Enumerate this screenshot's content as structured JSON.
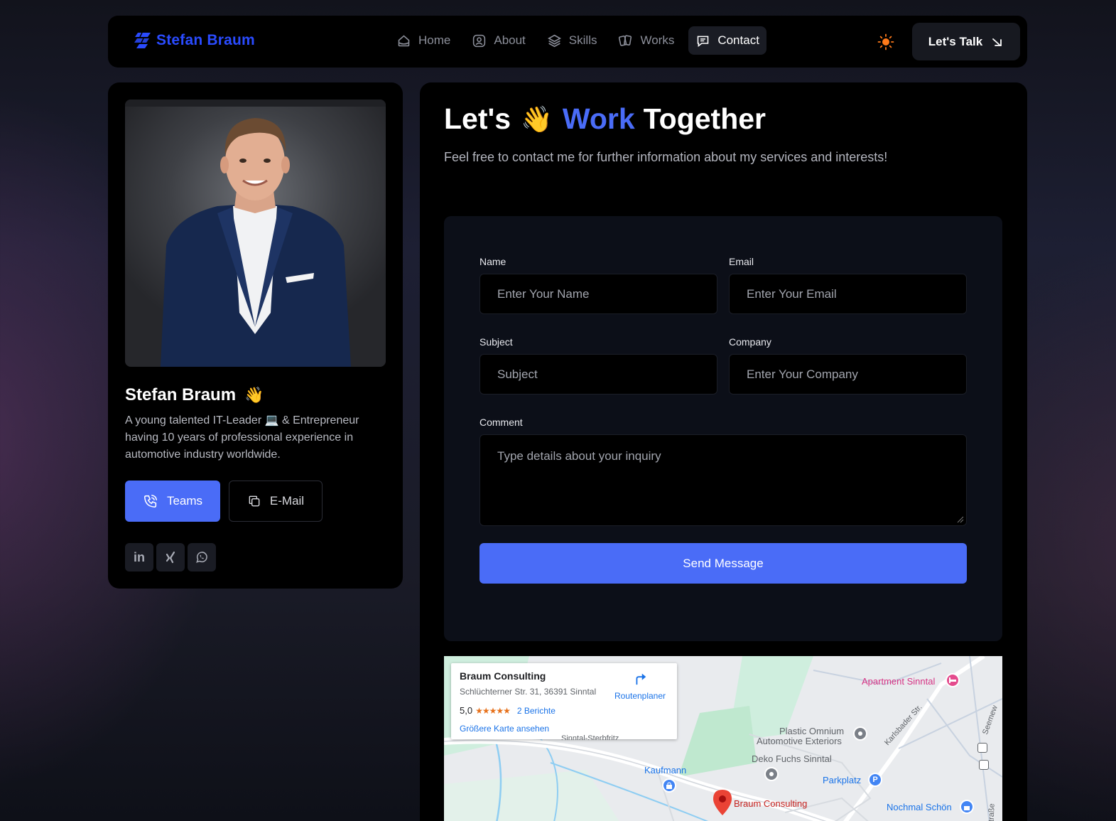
{
  "nav": {
    "logo": "Stefan Braum",
    "links": [
      {
        "label": "Home",
        "icon": "home-icon"
      },
      {
        "label": "About",
        "icon": "user-icon"
      },
      {
        "label": "Skills",
        "icon": "layers-icon"
      },
      {
        "label": "Works",
        "icon": "cards-icon"
      },
      {
        "label": "Contact",
        "icon": "message-icon"
      }
    ],
    "theme_icon": "sun-icon",
    "cta_label": "Let's Talk"
  },
  "profile": {
    "name": "Stefan Braum",
    "description": "A young talented IT-Leader 💻 & Entrepreneur having 10 years of professional experience in automotive industry worldwide.",
    "teams_label": "Teams",
    "email_label": "E-Mail",
    "socials": [
      "linkedin-icon",
      "xing-icon",
      "whatsapp-icon"
    ]
  },
  "contact": {
    "heading_pre": "Let's",
    "heading_accent": "Work",
    "heading_post": "Together",
    "subtitle": "Feel free to contact me for further information about my services and interests!",
    "form": {
      "name_label": "Name",
      "name_placeholder": "Enter Your Name",
      "email_label": "Email",
      "email_placeholder": "Enter Your Email",
      "subject_label": "Subject",
      "subject_placeholder": "Subject",
      "company_label": "Company",
      "company_placeholder": "Enter Your Company",
      "comment_label": "Comment",
      "comment_placeholder": "Type details about your inquiry",
      "send_label": "Send Message"
    }
  },
  "map": {
    "place_title": "Braum Consulting",
    "address": "Schlüchterner Str. 31, 36391 Sinntal",
    "rating": "5,0",
    "stars": "★★★★★",
    "reviews": "2 Berichte",
    "larger_map": "Größere Karte ansehen",
    "route_label": "Routenplaner",
    "labels": {
      "apartment": "Apartment Sinntal",
      "plastic_line1": "Plastic Omnium",
      "plastic_line2": "Automotive Exteriors",
      "deko": "Deko Fuchs Sinntal",
      "kaufmann": "Kaufmann",
      "parkplatz": "Parkplatz",
      "braum": "Braum Consulting",
      "nochmal": "Nochmal Schön",
      "karlsbader": "Karlsbader Str.",
      "seemew": "Seemew",
      "sinntal_str": "Sinntal-Sterbfritz",
      "einstrasse": "einstraße"
    }
  }
}
